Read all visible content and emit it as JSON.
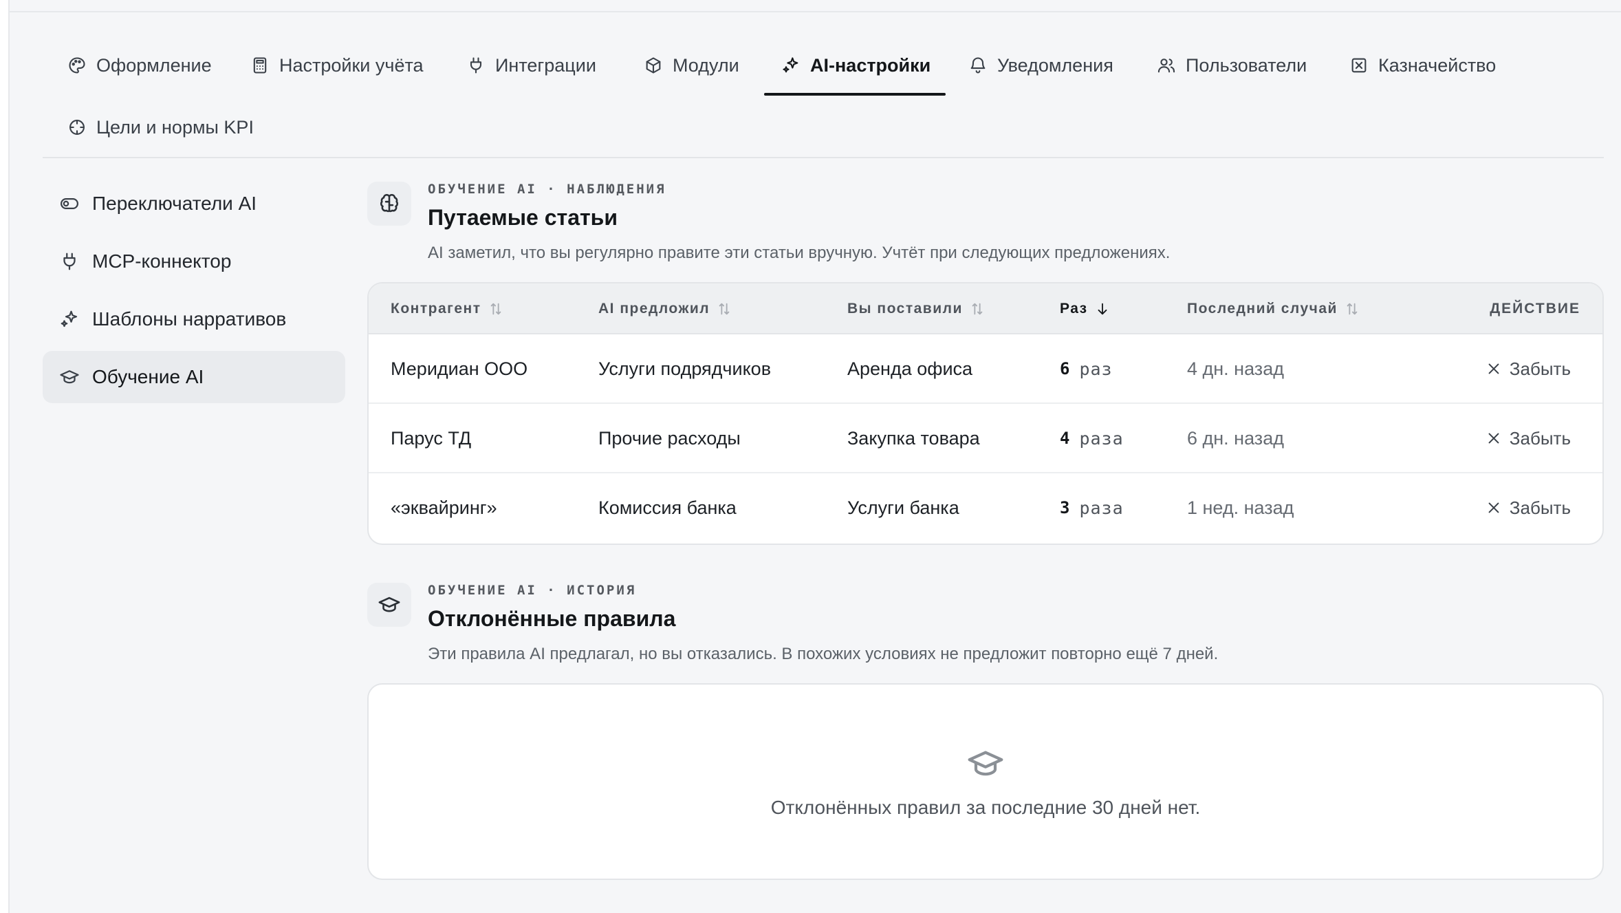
{
  "tabs": [
    {
      "label": "Оформление",
      "icon": "palette-icon",
      "active": false
    },
    {
      "label": "Настройки учёта",
      "icon": "calculator-icon",
      "active": false
    },
    {
      "label": "Интеграции",
      "icon": "plug-icon",
      "active": false
    },
    {
      "label": "Модули",
      "icon": "box-icon",
      "active": false
    },
    {
      "label": "AI-настройки",
      "icon": "sparkles-icon",
      "active": true
    },
    {
      "label": "Уведомления",
      "icon": "bell-icon",
      "active": false
    },
    {
      "label": "Пользователи",
      "icon": "users-icon",
      "active": false
    },
    {
      "label": "Казначейство",
      "icon": "treasury-icon",
      "active": false
    },
    {
      "label": "Цели и нормы KPI",
      "icon": "target-icon",
      "active": false
    }
  ],
  "sidebar": {
    "items": [
      {
        "label": "Переключатели AI",
        "icon": "toggle-icon",
        "active": false
      },
      {
        "label": "MCP-коннектор",
        "icon": "plug-icon",
        "active": false
      },
      {
        "label": "Шаблоны нарративов",
        "icon": "sparkles-icon",
        "active": false
      },
      {
        "label": "Обучение AI",
        "icon": "graduation-cap-icon",
        "active": true
      }
    ]
  },
  "confused": {
    "eyebrow": "ОБУЧЕНИЕ AI · НАБЛЮДЕНИЯ",
    "title": "Путаемые статьи",
    "description": "AI заметил, что вы регулярно правите эти статьи вручную. Учтёт при следующих предложениях.",
    "columns": {
      "counterparty": "Контрагент",
      "ai_suggested": "AI предложил",
      "you_set": "Вы поставили",
      "times": "Раз",
      "last_case": "Последний случай",
      "action": "ДЕЙСТВИЕ"
    },
    "rows": [
      {
        "counterparty": "Меридиан ООО",
        "ai_suggested": "Услуги подрядчиков",
        "you_set": "Аренда офиса",
        "count": "6",
        "unit": "раз",
        "last": "4 дн. назад",
        "action": "Забыть"
      },
      {
        "counterparty": "Парус ТД",
        "ai_suggested": "Прочие расходы",
        "you_set": "Закупка товара",
        "count": "4",
        "unit": "раза",
        "last": "6 дн. назад",
        "action": "Забыть"
      },
      {
        "counterparty": "«эквайринг»",
        "ai_suggested": "Комиссия банка",
        "you_set": "Услуги банка",
        "count": "3",
        "unit": "раза",
        "last": "1 нед. назад",
        "action": "Забыть"
      }
    ]
  },
  "rejected": {
    "eyebrow": "ОБУЧЕНИЕ AI · ИСТОРИЯ",
    "title": "Отклонённые правила",
    "description": "Эти правила AI предлагал, но вы отказались. В похожих условиях не предложит повторно ещё 7 дней.",
    "empty": "Отклонённых правил за последние 30 дней нет."
  }
}
